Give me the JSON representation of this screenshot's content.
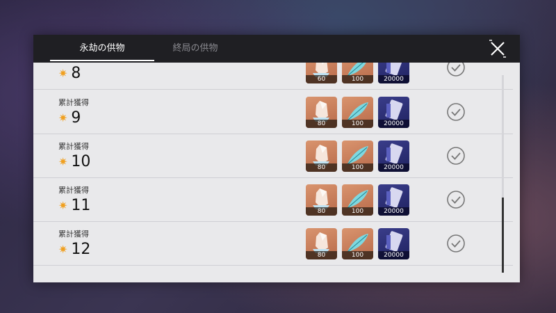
{
  "tabs": [
    {
      "label": "永劫の供物"
    },
    {
      "label": "終局の供物"
    }
  ],
  "rows": [
    {
      "label": "",
      "number": "8",
      "qty": [
        "60",
        "100",
        "20000"
      ]
    },
    {
      "label": "累計獲得",
      "number": "9",
      "qty": [
        "80",
        "100",
        "20000"
      ]
    },
    {
      "label": "累計獲得",
      "number": "10",
      "qty": [
        "80",
        "100",
        "20000"
      ]
    },
    {
      "label": "累計獲得",
      "number": "11",
      "qty": [
        "80",
        "100",
        "20000"
      ]
    },
    {
      "label": "累計獲得",
      "number": "12",
      "qty": [
        "80",
        "100",
        "20000"
      ]
    }
  ],
  "icons": {
    "close": "close-icon",
    "star": "star-icon",
    "check": "check-circle-icon",
    "items": [
      "crystal-icon",
      "feather-icon",
      "ticket-icon"
    ]
  },
  "colors": {
    "accent_star": "#f0a020",
    "header_bg": "#1f1f23",
    "panel_bg": "#e9e9eb"
  }
}
